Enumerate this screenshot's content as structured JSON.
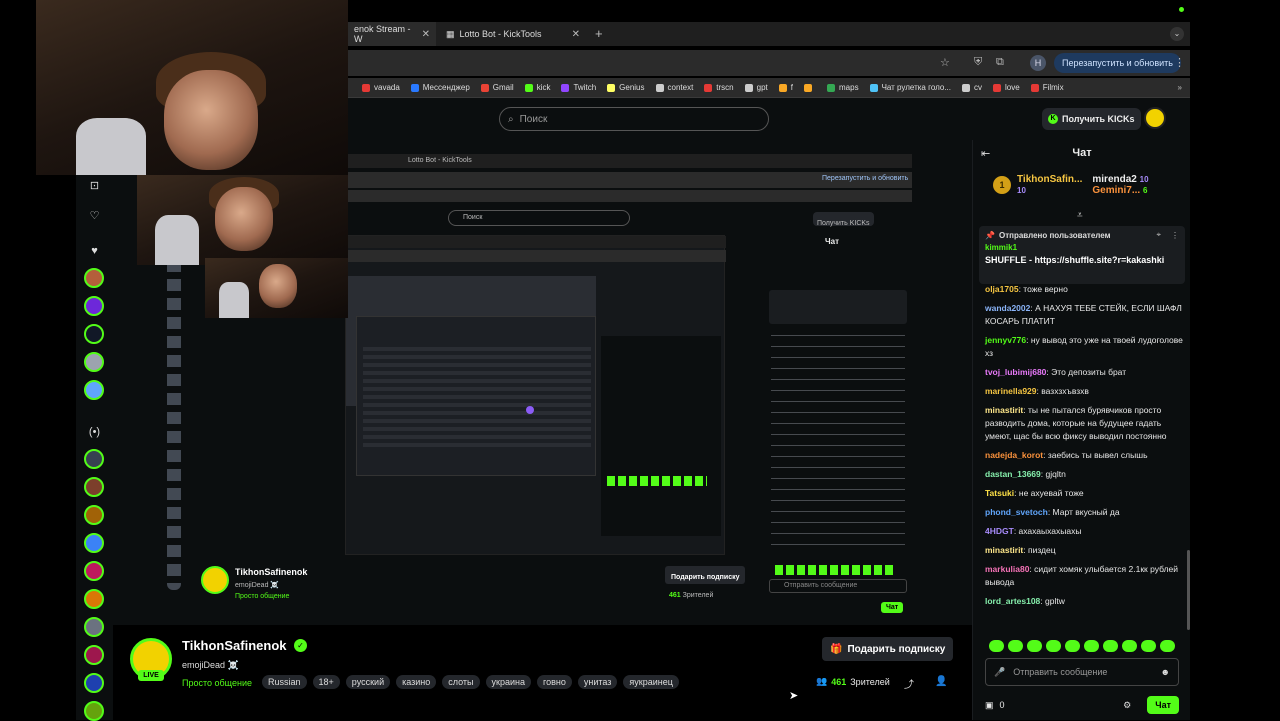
{
  "browser": {
    "tabs": [
      {
        "label": "enok Stream - W"
      },
      {
        "label": "Lotto Bot - KickTools"
      }
    ],
    "new_tab_icon": "plus-icon",
    "relaunch_label": "Перезапустить и обновить",
    "profile_initial": "Н",
    "bookmarks": [
      {
        "label": "vavada",
        "color": "#e53935"
      },
      {
        "label": "Мессенджер",
        "color": "#2979ff"
      },
      {
        "label": "Gmail",
        "color": "#ea4335"
      },
      {
        "label": "kick",
        "color": "#53fc18"
      },
      {
        "label": "Twitch",
        "color": "#9146ff"
      },
      {
        "label": "Genius",
        "color": "#ffff64"
      },
      {
        "label": "context",
        "color": "#cccccc"
      },
      {
        "label": "trscn",
        "color": "#e53935"
      },
      {
        "label": "gpt",
        "color": "#cccccc"
      },
      {
        "label": "f",
        "color": "#f9a825"
      },
      {
        "label": "",
        "color": "#f9a825"
      },
      {
        "label": "maps",
        "color": "#34a853"
      },
      {
        "label": "Чат рулетка голо...",
        "color": "#4fc3f7"
      },
      {
        "label": "cv",
        "color": "#cccccc"
      },
      {
        "label": "love",
        "color": "#e53935"
      },
      {
        "label": "Filmix",
        "color": "#e53935"
      }
    ]
  },
  "kick": {
    "search_placeholder": "Поиск",
    "get_kicks_label": "Получить KICKs"
  },
  "chat": {
    "title": "Чат",
    "leaderboard": {
      "first_rank": "1",
      "first_name": "TikhonSafin...",
      "first_value": "10",
      "second_name": "mirenda2",
      "second_value": "10",
      "third_name": "Gemini7...",
      "third_value": "6"
    },
    "pinned": {
      "header": "Отправлено пользователем",
      "user": "kimmik1",
      "text": "SHUFFLE - https://shuffle.site?r=kakashki"
    },
    "messages": [
      {
        "user": "olja1705",
        "text": "тоже верно",
        "color": "#f5c542"
      },
      {
        "user": "wanda2002",
        "text": "А НАХУЯ ТЕБЕ СТЕЙК, ЕСЛИ ШАФЛ КОСАРЬ ПЛАТИТ",
        "color": "#8ab4f8"
      },
      {
        "user": "jennyv776",
        "text": "ну вывод это уже на твоей лудоголове хз",
        "color": "#53fc18"
      },
      {
        "user": "tvoj_lubimij680",
        "text": "Это депозиты брат",
        "color": "#e879f9"
      },
      {
        "user": "marinella929",
        "text": "вазхзхъвзхв",
        "color": "#f5c542"
      },
      {
        "user": "minastirit",
        "text": "ты не пытался бурявчиков просто разводить дома, которые на будущее гадать умеют, щас бы всю фиксу выводил постоянно",
        "color": "#fde68a"
      },
      {
        "user": "nadejda_korot",
        "text": "заебись ты вывел слышь",
        "color": "#fb923c"
      },
      {
        "user": "dastan_13669",
        "text": "gjqltn",
        "color": "#86efac"
      },
      {
        "user": "Tatsuki",
        "text": "не ахуевай тоже",
        "color": "#fde047"
      },
      {
        "user": "phond_svetoch",
        "text": "Март вкусный да",
        "color": "#60a5fa"
      },
      {
        "user": "4HDGT",
        "text": "ахахаыхахыахы",
        "color": "#a78bfa"
      },
      {
        "user": "minastirit",
        "text": "пиздец",
        "color": "#fde68a"
      },
      {
        "user": "markulia80",
        "text": "сидит хомяк улыбается 2.1кк рублей вывода",
        "color": "#f472b6"
      },
      {
        "user": "lord_artes108",
        "text": "gpltw",
        "color": "#86efac"
      }
    ],
    "input_placeholder": "Отправить сообщение",
    "kicks_count": "0",
    "send_label": "Чат"
  },
  "stream": {
    "streamer": "TikhonSafinenok",
    "title": "emojiDead ☠️",
    "live_label": "LIVE",
    "category": "Просто общение",
    "tags": [
      "Russian",
      "18+",
      "русский",
      "казино",
      "слоты",
      "украина",
      "говно",
      "унитаз",
      "яукраинец"
    ],
    "gift_label": "Подарить подписку",
    "viewers_count": "461",
    "viewers_label": "Зрителей"
  },
  "nested": {
    "name": "TikhonSafinenok",
    "title": "emojiDead ☠️",
    "category": "Просто общение",
    "gift_label": "Подарить подписку",
    "viewers_count": "461",
    "viewers_label": "Зрителей",
    "chat_title": "Чат",
    "search_placeholder": "Поиск",
    "tab_label": "Lotto Bot - KickTools",
    "get_kicks_label": "Получить KICKs",
    "send_label": "Чат",
    "input_placeholder": "Отправить сообщение"
  }
}
